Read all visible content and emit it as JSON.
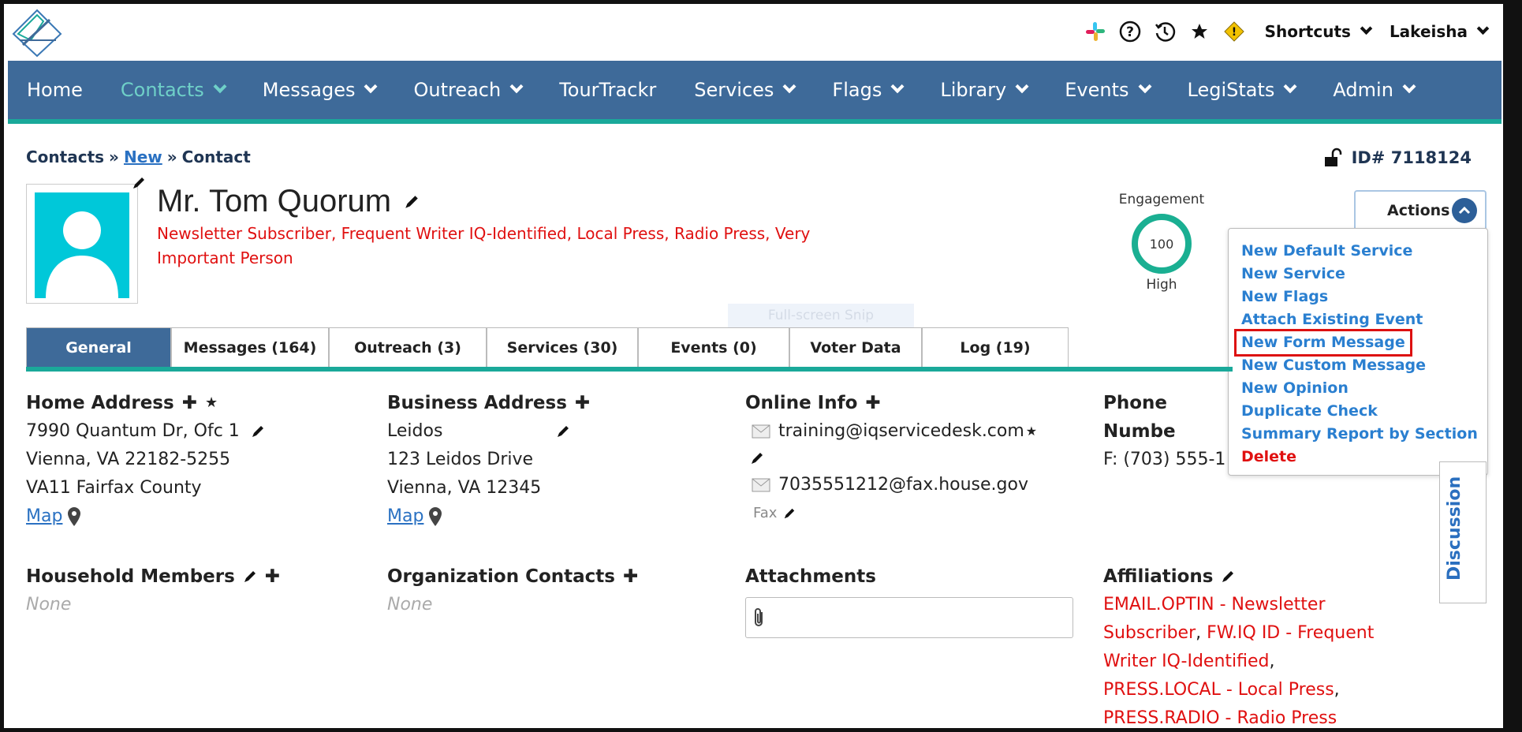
{
  "topbar": {
    "shortcuts_label": "Shortcuts",
    "user_label": "Lakeisha"
  },
  "nav": {
    "items": [
      {
        "label": "Home"
      },
      {
        "label": "Contacts"
      },
      {
        "label": "Messages"
      },
      {
        "label": "Outreach"
      },
      {
        "label": "TourTrackr"
      },
      {
        "label": "Services"
      },
      {
        "label": "Flags"
      },
      {
        "label": "Library"
      },
      {
        "label": "Events"
      },
      {
        "label": "LegiStats"
      },
      {
        "label": "Admin"
      }
    ]
  },
  "breadcrumb": {
    "root": "Contacts",
    "sep1": "»",
    "link": "New",
    "sep2": "»",
    "current": "Contact"
  },
  "contact": {
    "id_label": "ID# 7118124",
    "name": "Mr. Tom Quorum",
    "tags": "Newsletter Subscriber, Frequent Writer IQ-Identified, Local Press, Radio Press, Very Important Person"
  },
  "engagement": {
    "label": "Engagement",
    "score": "100",
    "level": "High"
  },
  "actions": {
    "button_label": "Actions",
    "items": [
      {
        "label": "New Default Service"
      },
      {
        "label": "New Service"
      },
      {
        "label": "New Flags"
      },
      {
        "label": "Attach Existing Event"
      },
      {
        "label": "New Form Message"
      },
      {
        "label": "New Custom Message"
      },
      {
        "label": "New Opinion"
      },
      {
        "label": "Duplicate Check"
      },
      {
        "label": "Summary Report by Section"
      },
      {
        "label": "Delete"
      }
    ]
  },
  "snip_overlay": "Full-screen Snip",
  "tabs": [
    {
      "label": "General"
    },
    {
      "label": "Messages (164)"
    },
    {
      "label": "Outreach (3)"
    },
    {
      "label": "Services (30)"
    },
    {
      "label": "Events (0)"
    },
    {
      "label": "Voter Data"
    },
    {
      "label": "Log (19)"
    }
  ],
  "discussion_label": "Discussion",
  "home_address": {
    "title": "Home Address",
    "line1": "7990 Quantum Dr, Ofc 1",
    "line2": "Vienna, VA 22182-5255",
    "line3": "VA11 Fairfax County",
    "map_label": "Map"
  },
  "business_address": {
    "title": "Business Address",
    "line1": "Leidos",
    "line2": "123 Leidos Drive",
    "line3": "Vienna, VA 12345",
    "map_label": "Map"
  },
  "online_info": {
    "title": "Online Info",
    "email": "training@iqservicedesk.com",
    "fax_email": "7035551212@fax.house.gov",
    "fax_label": "Fax"
  },
  "phone": {
    "title": "Phone Numbe",
    "line1": "F: (703) 555-1"
  },
  "household": {
    "title": "Household Members",
    "value": "None"
  },
  "org_contacts": {
    "title": "Organization Contacts",
    "value": "None"
  },
  "attachments": {
    "title": "Attachments"
  },
  "affiliations": {
    "title": "Affiliations",
    "l1": "EMAIL.OPTIN - Newsletter",
    "l2a": "Subscriber",
    "l2b": ", ",
    "l2c": "FW.IQ ID - Frequent",
    "l3a": "Writer IQ-Identified",
    "l3b": ",",
    "l4a": "PRESS.LOCAL - Local Press",
    "l4b": ",",
    "l5": "PRESS.RADIO - Radio Press"
  }
}
